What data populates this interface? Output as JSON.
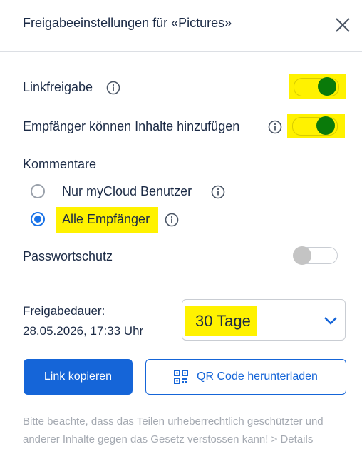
{
  "dialog": {
    "title": "Freigabeeinstellungen für «Pictures»",
    "close_icon": "close-icon"
  },
  "settings": {
    "link_share": {
      "label": "Linkfreigabe",
      "enabled": true
    },
    "recipients_add": {
      "label": "Empfänger können Inhalte hinzufügen",
      "enabled": true
    },
    "comments": {
      "heading": "Kommentare",
      "options": [
        {
          "label": "Nur myCloud Benutzer",
          "selected": false
        },
        {
          "label": "Alle Empfänger",
          "selected": true
        }
      ]
    },
    "password": {
      "label": "Passwortschutz",
      "enabled": false
    }
  },
  "duration": {
    "label": "Freigabedauer:",
    "expires": "28.05.2026, 17:33 Uhr",
    "selected": "30 Tage"
  },
  "actions": {
    "copy_link": "Link kopieren",
    "qr_download": "QR Code herunterladen"
  },
  "footnote": "Bitte beachte, dass das Teilen urheberrechtlich geschützter und anderer Inhalte gegen das Gesetz verstossen kann! > Details",
  "colors": {
    "accent": "#1565d8",
    "toggle_on": "#0a7a0a",
    "highlight": "#fff200",
    "toggle_off": "#c4c4c4"
  }
}
